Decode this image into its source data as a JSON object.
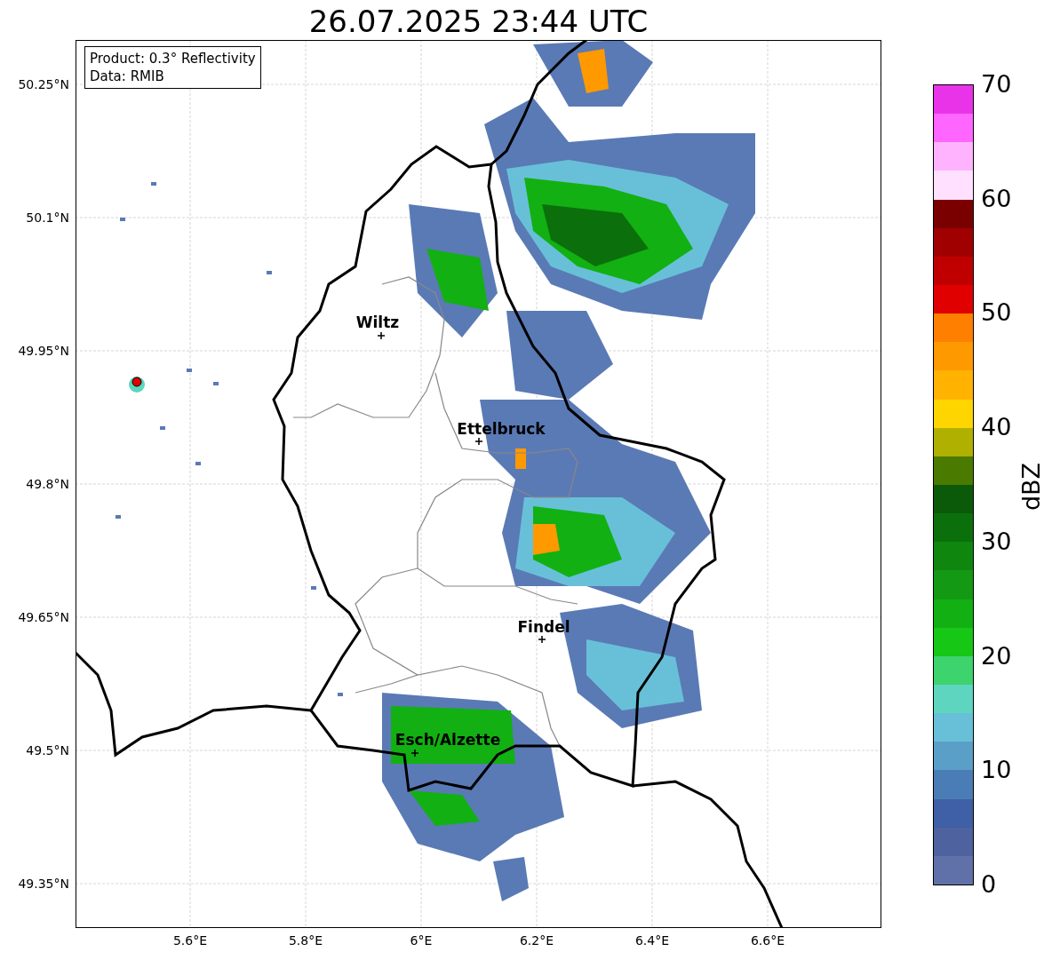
{
  "title": "26.07.2025 23:44 UTC",
  "map": {
    "info_lines": [
      "Product: 0.3° Reflectivity",
      "Data: RMIB"
    ],
    "cities": [
      {
        "name": "Wiltz"
      },
      {
        "name": "Ettelbruck"
      },
      {
        "name": "Findel"
      },
      {
        "name": "Esch/Alzette"
      }
    ],
    "yticks": [
      "50.25°N",
      "50.1°N",
      "49.95°N",
      "49.8°N",
      "49.65°N",
      "49.5°N",
      "49.35°N"
    ],
    "xticks": [
      "5.6°E",
      "5.8°E",
      "6°E",
      "6.2°E",
      "6.4°E",
      "6.6°E"
    ]
  },
  "colorbar": {
    "label": "dBZ",
    "ticks": [
      "70",
      "60",
      "50",
      "40",
      "30",
      "20",
      "10",
      "0"
    ],
    "bins": [
      {
        "color": "#e933e9"
      },
      {
        "color": "#ff66ff"
      },
      {
        "color": "#ffb3ff"
      },
      {
        "color": "#ffe0ff"
      },
      {
        "color": "#7a0000"
      },
      {
        "color": "#a00000"
      },
      {
        "color": "#c00000"
      },
      {
        "color": "#e00000"
      },
      {
        "color": "#ff7f00"
      },
      {
        "color": "#ff9900"
      },
      {
        "color": "#ffb300"
      },
      {
        "color": "#ffd500"
      },
      {
        "color": "#b0b000"
      },
      {
        "color": "#4a7a00"
      },
      {
        "color": "#0a5a0a"
      },
      {
        "color": "#0b700b"
      },
      {
        "color": "#0f870f"
      },
      {
        "color": "#139913"
      },
      {
        "color": "#12b012"
      },
      {
        "color": "#16c716"
      },
      {
        "color": "#3dd36d"
      },
      {
        "color": "#5ed6bf"
      },
      {
        "color": "#68c0d8"
      },
      {
        "color": "#5a9fc7"
      },
      {
        "color": "#4a7db5"
      },
      {
        "color": "#3f5fa6"
      },
      {
        "color": "#4f62a0"
      },
      {
        "color": "#6070a8"
      }
    ]
  }
}
